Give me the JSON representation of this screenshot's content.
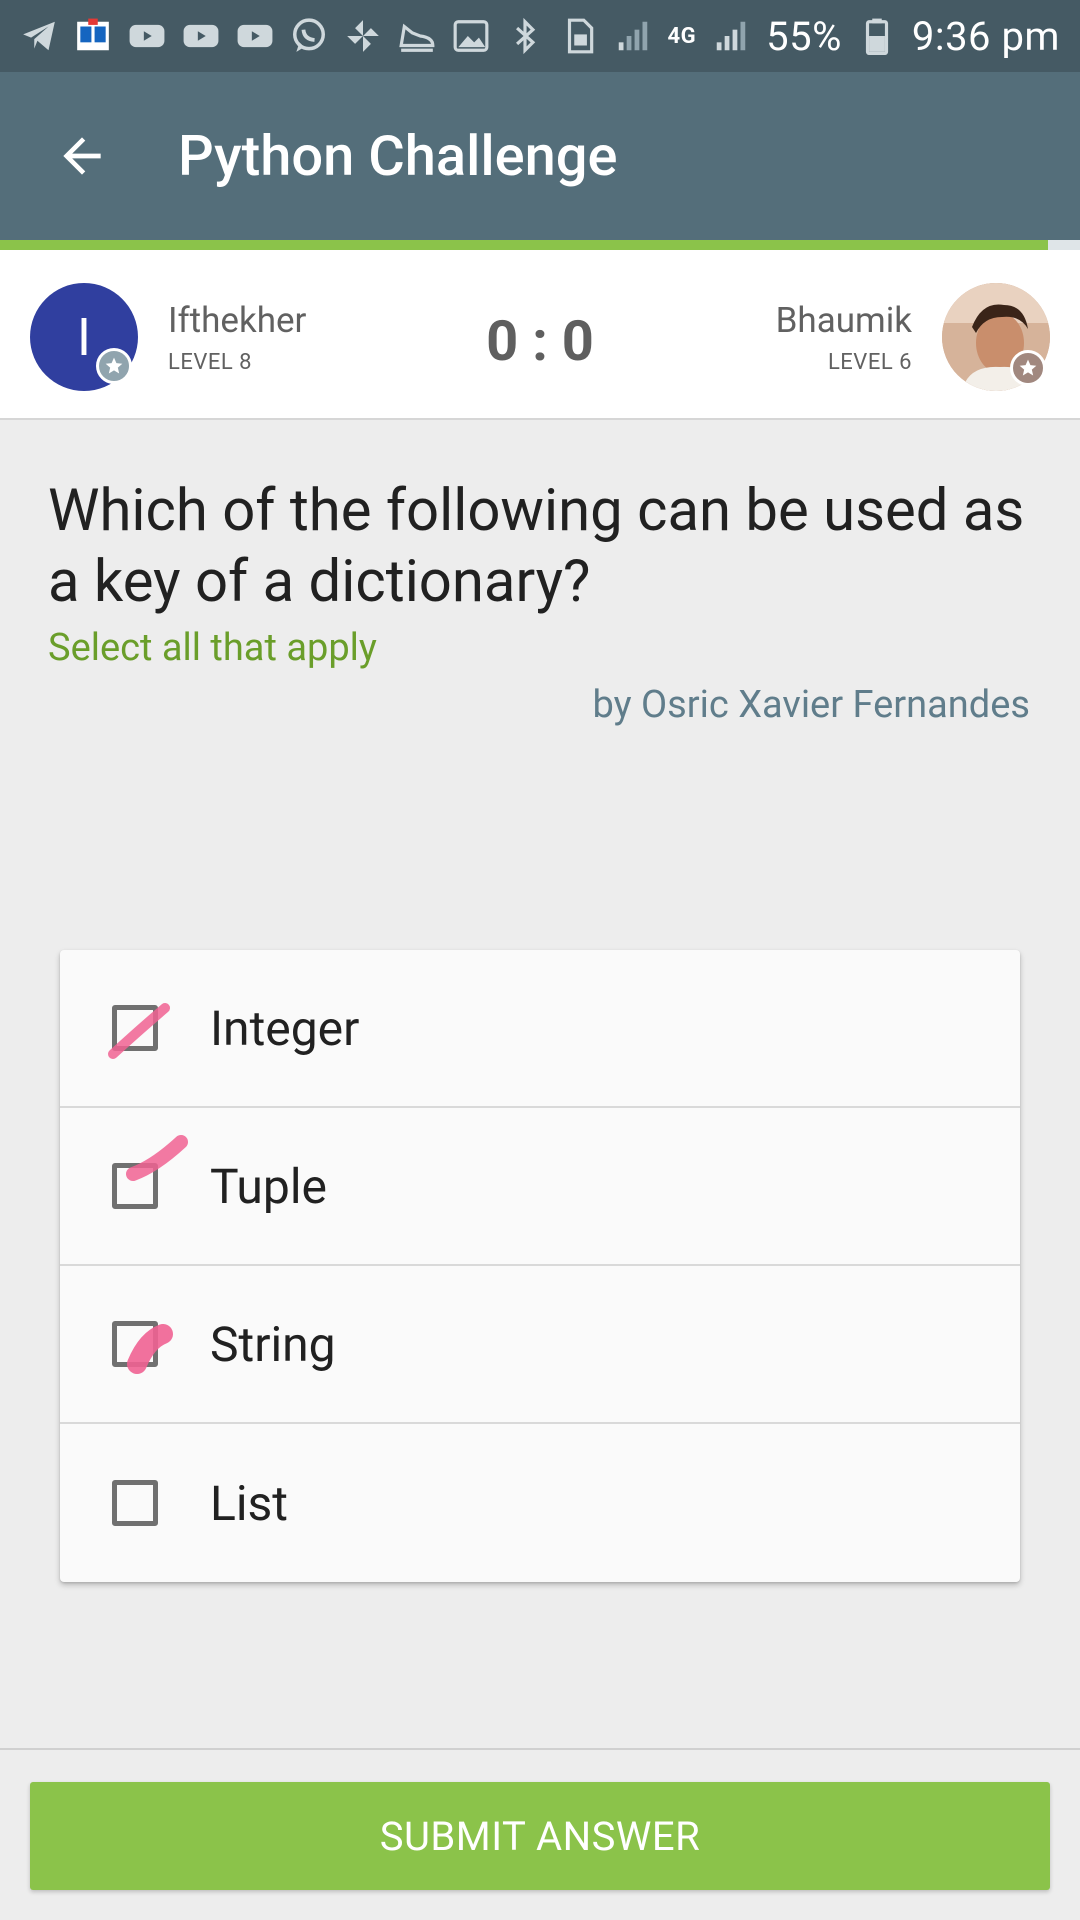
{
  "status_bar": {
    "battery": "55%",
    "time": "9:36 pm",
    "network": "4G",
    "left_icons": [
      "telegram-icon",
      "app-icon",
      "youtube-icon",
      "youtube-icon",
      "youtube-icon",
      "whatsapp-icon",
      "pinwheel-icon",
      "shoe-icon",
      "image-icon"
    ],
    "right_icons": [
      "bluetooth-icon",
      "sim-icon",
      "signal-icon",
      "data-icon",
      "signal-icon",
      "battery-icon"
    ]
  },
  "app_bar": {
    "title": "Python Challenge",
    "back_icon": "arrow-back-icon"
  },
  "progress": {
    "value": 0.97,
    "color": "#8bc34a"
  },
  "players": {
    "left": {
      "initial": "I",
      "name": "Ifthekher",
      "level": "LEVEL 8"
    },
    "right": {
      "name": "Bhaumik",
      "level": "LEVEL 6"
    },
    "score": "0 : 0"
  },
  "question": {
    "text": "Which of the following can be used as a key of a dictionary?",
    "hint": "Select all that apply",
    "author": "by Osric Xavier Fernandes"
  },
  "options": [
    {
      "label": "Integer"
    },
    {
      "label": "Tuple"
    },
    {
      "label": "String"
    },
    {
      "label": "List"
    }
  ],
  "submit": {
    "label": "SUBMIT ANSWER"
  },
  "colors": {
    "status_bar": "#455a64",
    "app_bar": "#546e7a",
    "accent": "#8bc34a",
    "hint": "#6a9e2a",
    "author": "#607d8b",
    "left_avatar": "#303f9f",
    "highlight_marks": "#f06292"
  }
}
